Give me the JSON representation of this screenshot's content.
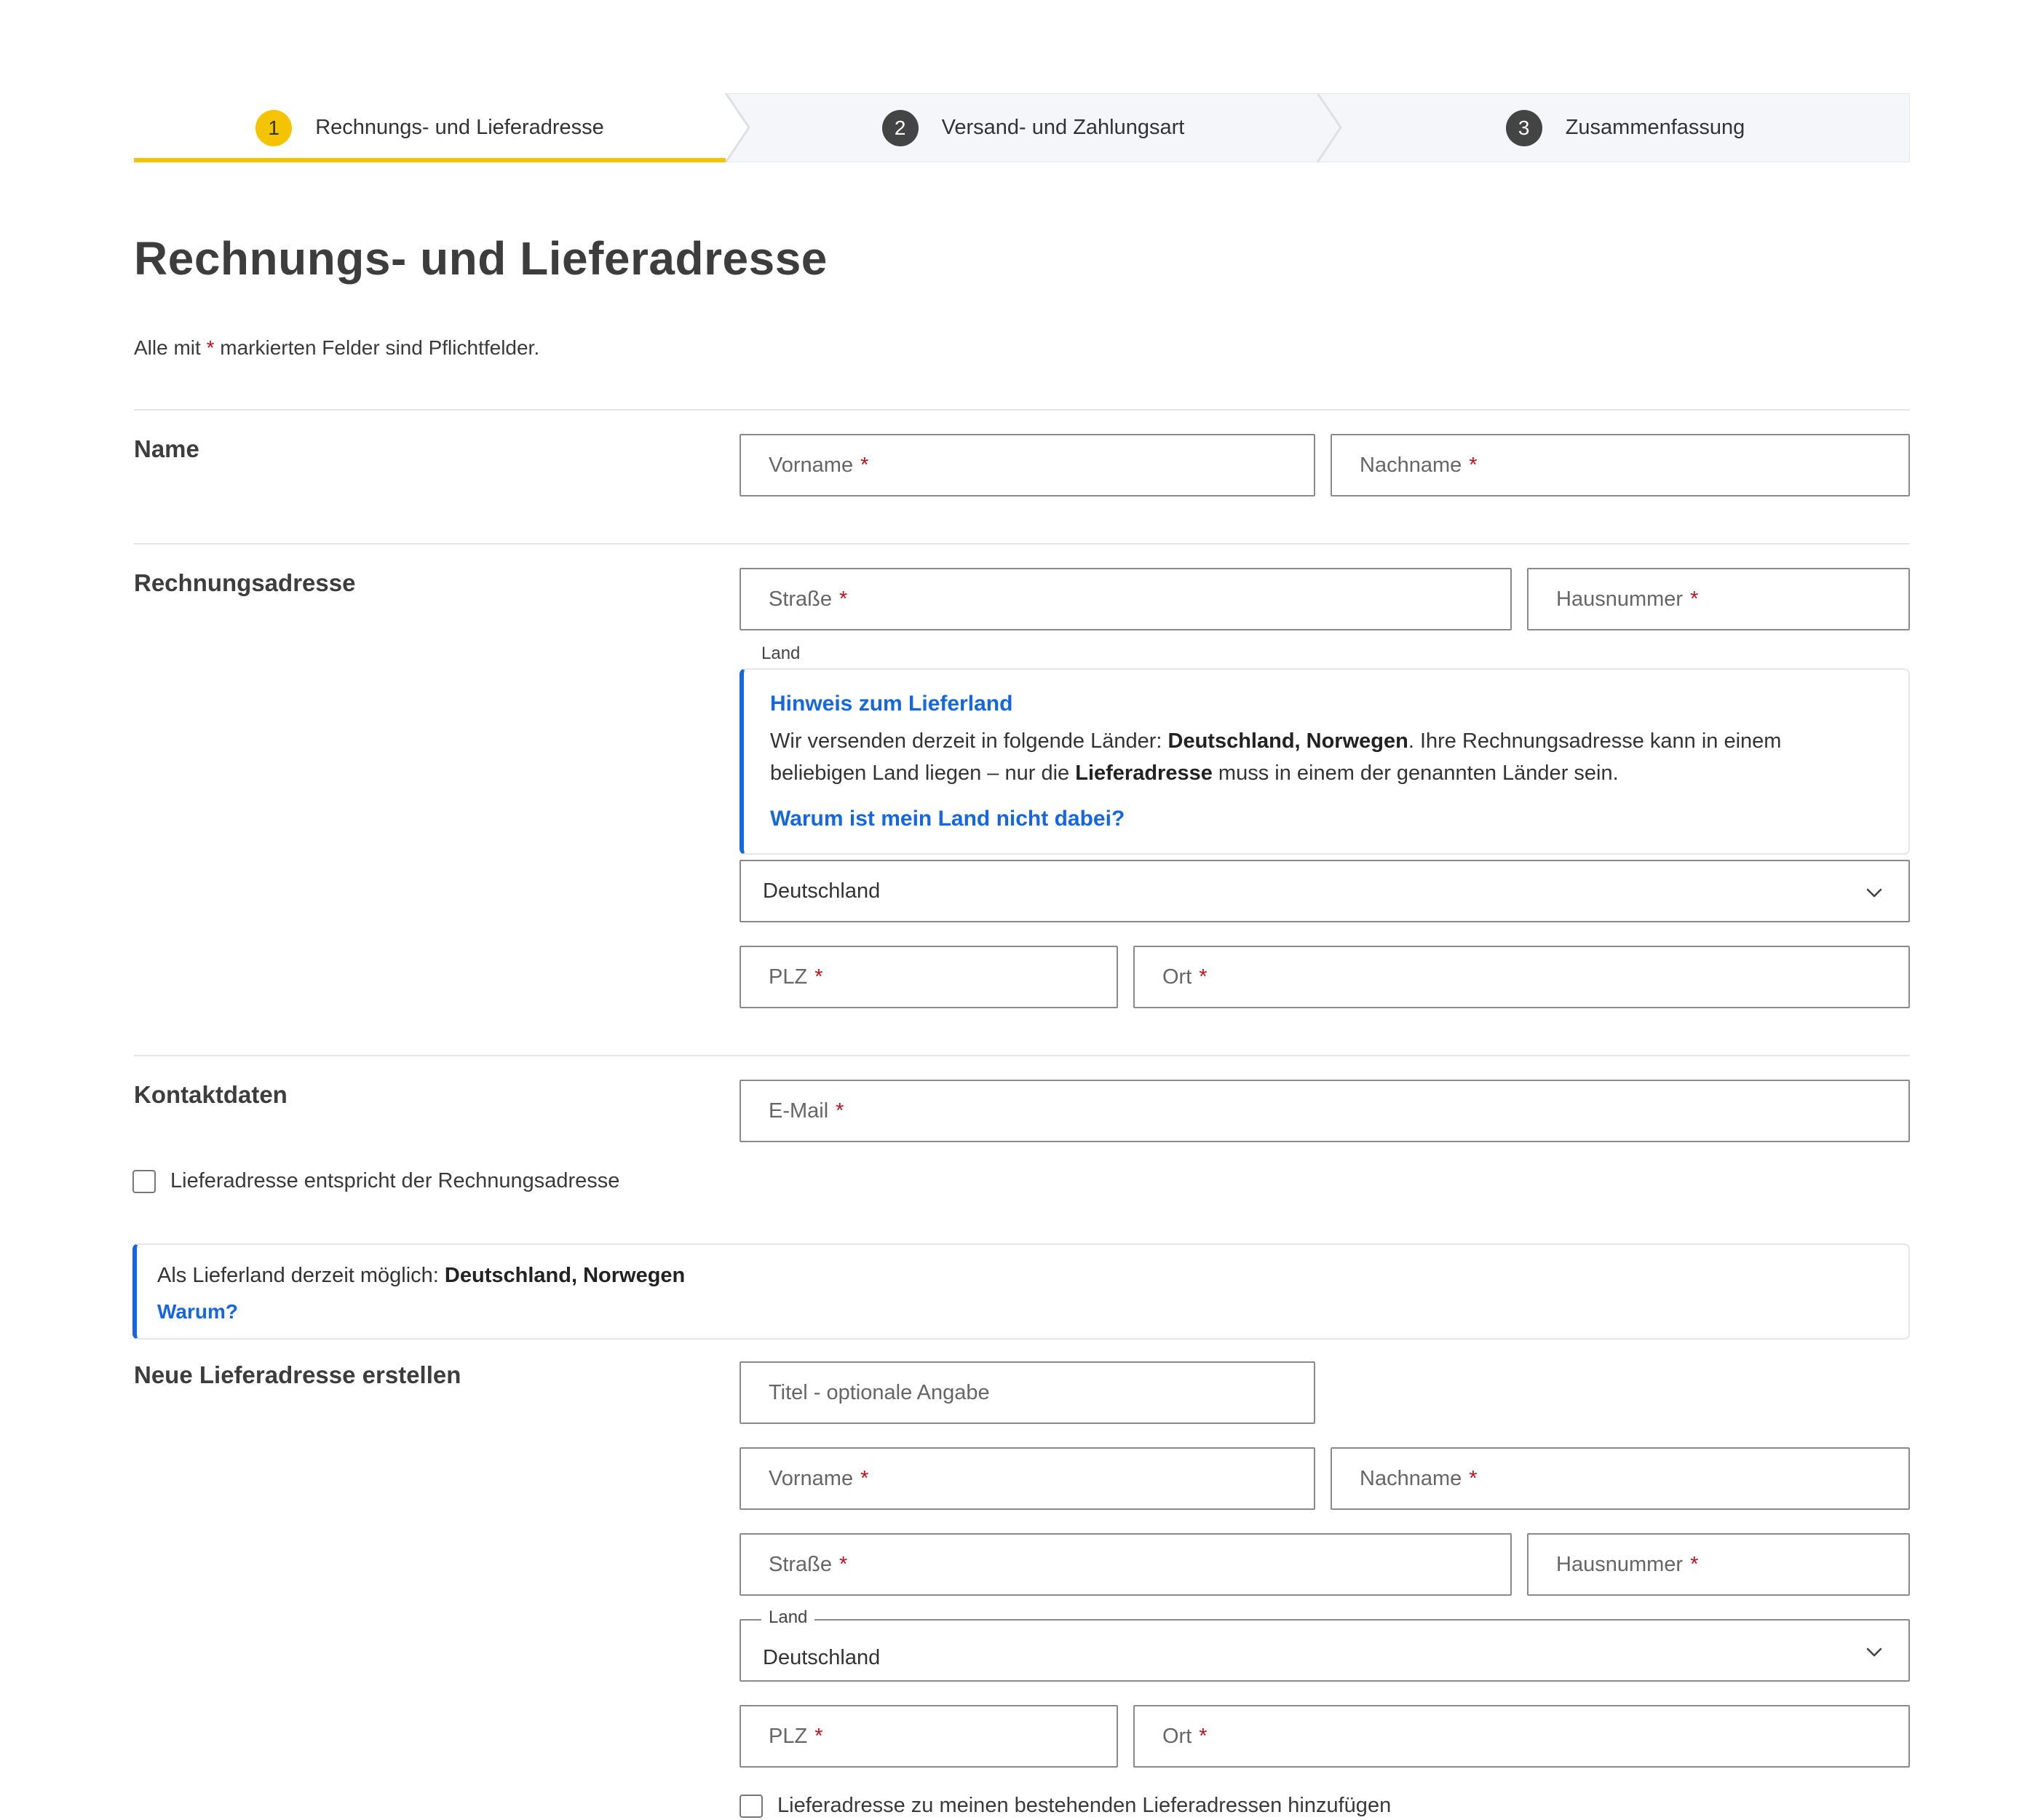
{
  "stepper": {
    "steps": [
      {
        "number": "1",
        "label": "Rechnungs- und Lieferadresse",
        "active": true
      },
      {
        "number": "2",
        "label": "Versand- und Zahlungsart",
        "active": false
      },
      {
        "number": "3",
        "label": "Zusammenfassung",
        "active": false
      }
    ],
    "active_color": "#f5c400"
  },
  "page": {
    "title": "Rechnungs- und Lieferadresse",
    "required_note_prefix": "Alle mit",
    "required_star": "*",
    "required_note_suffix": "markierten Felder sind Pflichtfelder."
  },
  "sections": {
    "name": {
      "label": "Name",
      "first_name_placeholder": "Vorname",
      "last_name_placeholder": "Nachname"
    },
    "billing": {
      "label": "Rechnungsadresse",
      "street_placeholder": "Straße",
      "house_number_placeholder": "Hausnummer",
      "country_label": "Land",
      "notice": {
        "title": "Hinweis zum Lieferland",
        "text_1": "Wir versenden derzeit in folgende Länder:",
        "countries": "Deutschland, Norwegen",
        "text_2": ". Ihre Rechnungsadresse kann in einem",
        "text_3": "beliebigen Land liegen – nur die",
        "delivery_address": "Lieferadresse",
        "text_4": "muss in einem der genannten Länder sein.",
        "link": "Warum ist mein Land nicht dabei?"
      },
      "country_value": "Deutschland",
      "zip_placeholder": "PLZ",
      "city_placeholder": "Ort"
    },
    "contact": {
      "label": "Kontaktdaten",
      "email_placeholder": "E-Mail"
    },
    "same_address_checkbox": {
      "label": "Lieferadresse entspricht der Rechnungsadresse",
      "checked": false
    },
    "delivery_notice": {
      "text": "Als Lieferland derzeit möglich:",
      "countries": "Deutschland, Norwegen",
      "link": "Warum?"
    },
    "new_delivery": {
      "label": "Neue Lieferadresse erstellen",
      "title_placeholder": "Titel - optionale Angabe",
      "first_name_placeholder": "Vorname",
      "last_name_placeholder": "Nachname",
      "street_placeholder": "Straße",
      "house_number_placeholder": "Hausnummer",
      "country_label": "Land",
      "country_value": "Deutschland",
      "zip_placeholder": "PLZ",
      "city_placeholder": "Ort"
    },
    "add_delivery_checkbox": {
      "label": "Lieferadresse zu meinen bestehenden Lieferadressen hinzufügen",
      "checked": false
    }
  },
  "colors": {
    "accent": "#f5c400",
    "link": "#1567e0",
    "required": "#c0121e",
    "border": "#8a8a8a"
  }
}
